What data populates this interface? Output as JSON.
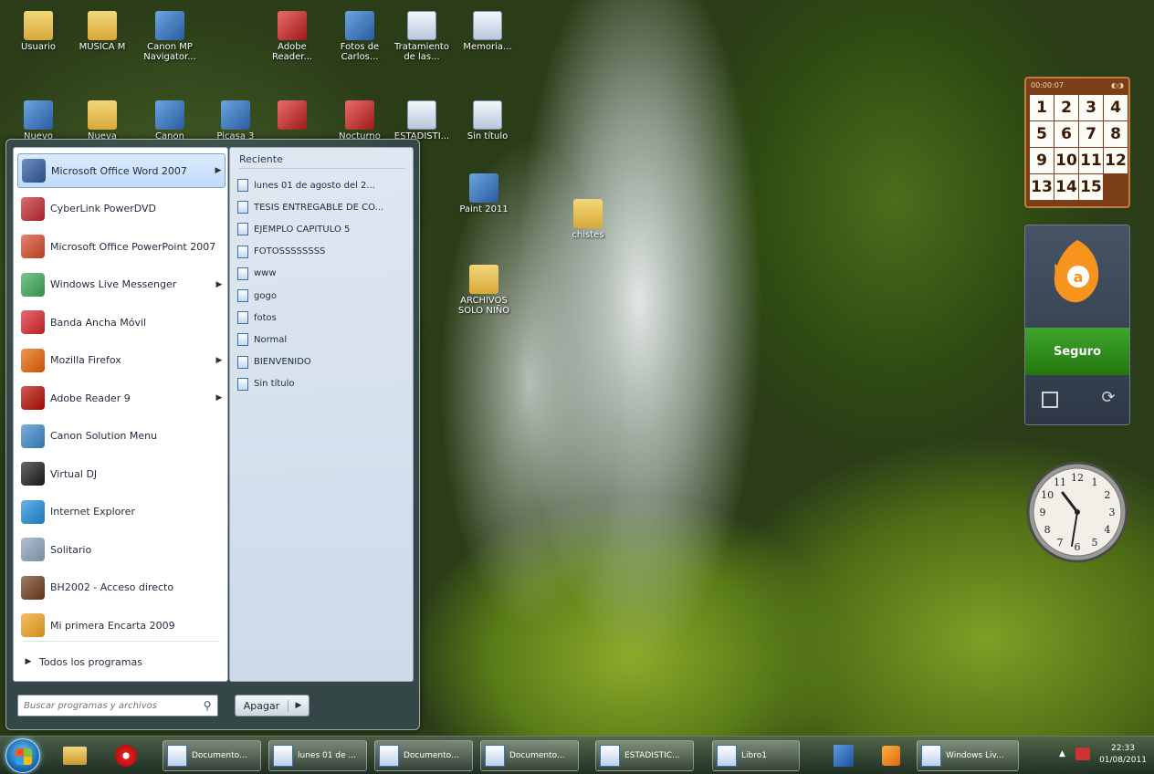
{
  "desktop": {
    "icons": [
      {
        "label": "Usuario",
        "kind": "folder"
      },
      {
        "label": "MUSICA M",
        "kind": "folder"
      },
      {
        "label": "Canon MP Navigator...",
        "kind": "app"
      },
      {
        "label": "Adobe Reader...",
        "kind": "red"
      },
      {
        "label": "Fotos de Carlos...",
        "kind": "app"
      },
      {
        "label": "Tratamiento de las...",
        "kind": "doc"
      },
      {
        "label": "Memoria...",
        "kind": "doc"
      },
      {
        "label": "Nuevo",
        "kind": "app"
      },
      {
        "label": "Nueva",
        "kind": "folder"
      },
      {
        "label": "Canon",
        "kind": "app"
      },
      {
        "label": "Picasa 3",
        "kind": "app"
      },
      {
        "label": "",
        "kind": "red"
      },
      {
        "label": "Nocturno",
        "kind": "red"
      },
      {
        "label": "ESTADISTI...",
        "kind": "doc"
      },
      {
        "label": "Sin título",
        "kind": "doc"
      },
      {
        "label": "Paint 2011",
        "kind": "app"
      },
      {
        "label": "chistes",
        "kind": "folder"
      },
      {
        "label": "ARCHIVOS SOLO NIÑO",
        "kind": "folder"
      }
    ]
  },
  "start_menu": {
    "programs": [
      {
        "label": "Microsoft Office Word 2007",
        "arrow": true,
        "selected": true,
        "color": "#2b579a"
      },
      {
        "label": "CyberLink PowerDVD",
        "arrow": false,
        "selected": false,
        "color": "#c0262d"
      },
      {
        "label": "Microsoft Office PowerPoint 2007",
        "arrow": false,
        "selected": false,
        "color": "#d24726"
      },
      {
        "label": "Windows Live Messenger",
        "arrow": true,
        "selected": false,
        "color": "#3aa655"
      },
      {
        "label": "Banda Ancha Móvil",
        "arrow": false,
        "selected": false,
        "color": "#d8232a"
      },
      {
        "label": "Mozilla Firefox",
        "arrow": true,
        "selected": false,
        "color": "#e66000"
      },
      {
        "label": "Adobe Reader 9",
        "arrow": true,
        "selected": false,
        "color": "#b30b00"
      },
      {
        "label": "Canon Solution Menu",
        "arrow": false,
        "selected": false,
        "color": "#3a86c8"
      },
      {
        "label": "Virtual DJ",
        "arrow": false,
        "selected": false,
        "color": "#1b1b1b"
      },
      {
        "label": "Internet Explorer",
        "arrow": false,
        "selected": false,
        "color": "#1d8ad8"
      },
      {
        "label": "Solitario",
        "arrow": false,
        "selected": false,
        "color": "#8aa0b8"
      },
      {
        "label": "BH2002 - Acceso directo",
        "arrow": false,
        "selected": false,
        "color": "#6b3a1a"
      },
      {
        "label": "Mi primera Encarta 2009",
        "arrow": false,
        "selected": false,
        "color": "#f0a01c"
      }
    ],
    "all_programs_label": "Todos los programas",
    "search_placeholder": "Buscar programas y archivos",
    "shutdown_label": "Apagar",
    "recent_title": "Reciente",
    "recent_items": [
      "lunes 01 de agosto del 2...",
      "TESIS ENTREGABLE DE CO...",
      "EJEMPLO CAPITULO 5",
      "FOTOSSSSSSSS",
      "www",
      "gogo",
      "fotos",
      "Normal",
      "BIENVENIDO",
      "Sin título"
    ]
  },
  "gadgets": {
    "puzzle": {
      "title": "00:00:07",
      "tiles": [
        "1",
        "2",
        "3",
        "4",
        "5",
        "6",
        "7",
        "8",
        "9",
        "10",
        "11",
        "12",
        "13",
        "14",
        "15",
        ""
      ]
    },
    "avast": {
      "status": "Seguro",
      "accent": "#f7941d"
    },
    "clock": {
      "numbers": [
        "12",
        "1",
        "2",
        "3",
        "4",
        "5",
        "6",
        "7",
        "8",
        "9",
        "10",
        "11"
      ]
    }
  },
  "taskbar": {
    "buttons": [
      "Documento...",
      "lunes 01 de ...",
      "Documento...",
      "Documento...",
      "ESTADISTIC...",
      "Libro1",
      "Windows Liv..."
    ],
    "time": "22:33",
    "date": "01/08/2011"
  }
}
